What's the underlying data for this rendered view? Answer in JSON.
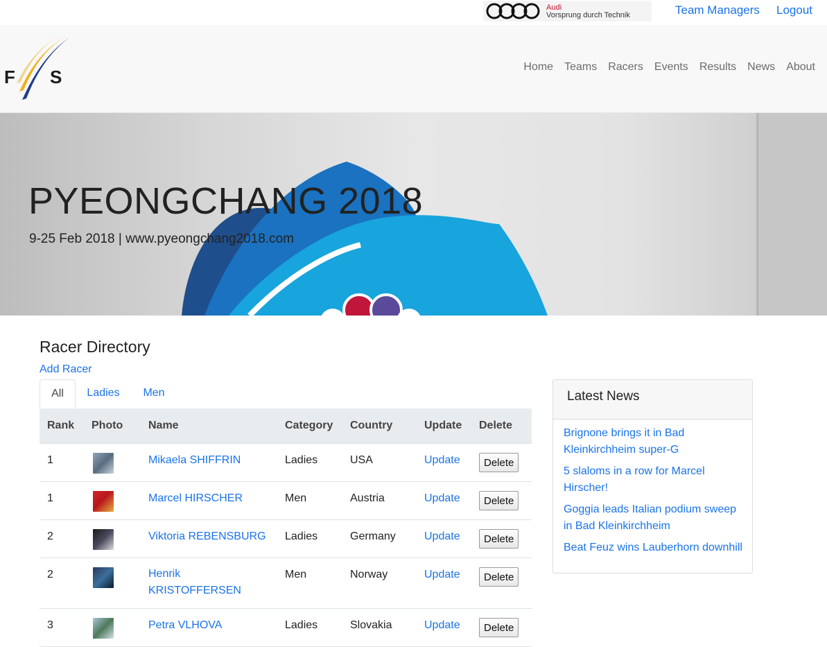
{
  "topbar": {
    "sponsor_brand": "Audi",
    "sponsor_tagline": "Vorsprung durch Technik",
    "team_managers": "Team Managers",
    "logout": "Logout"
  },
  "nav": {
    "items": [
      "Home",
      "Teams",
      "Racers",
      "Events",
      "Results",
      "News",
      "About"
    ]
  },
  "hero": {
    "title": "PYEONGCHANG 2018",
    "subtitle": "9-25 Feb 2018 | www.pyeongchang2018.com"
  },
  "directory": {
    "title": "Racer Directory",
    "add_racer": "Add Racer",
    "tabs": [
      "All",
      "Ladies",
      "Men"
    ],
    "active_tab": "All",
    "columns": [
      "Rank",
      "Photo",
      "Name",
      "Category",
      "Country",
      "Update",
      "Delete"
    ],
    "rows": [
      {
        "rank": "1",
        "name": "Mikaela SHIFFRIN",
        "category": "Ladies",
        "country": "USA",
        "update": "Update",
        "delete": "Delete"
      },
      {
        "rank": "1",
        "name": "Marcel HIRSCHER",
        "category": "Men",
        "country": "Austria",
        "update": "Update",
        "delete": "Delete"
      },
      {
        "rank": "2",
        "name": "Viktoria REBENSBURG",
        "category": "Ladies",
        "country": "Germany",
        "update": "Update",
        "delete": "Delete"
      },
      {
        "rank": "2",
        "name": "Henrik KRISTOFFERSEN",
        "category": "Men",
        "country": "Norway",
        "update": "Update",
        "delete": "Delete"
      },
      {
        "rank": "3",
        "name": "Petra VLHOVA",
        "category": "Ladies",
        "country": "Slovakia",
        "update": "Update",
        "delete": "Delete"
      }
    ]
  },
  "news": {
    "title": "Latest News",
    "items": [
      "Brignone brings it in Bad Kleinkirchheim super-G",
      "5 slaloms in a row for Marcel Hirscher!",
      "Goggia leads Italian podium sweep in Bad Kleinkirchheim",
      "Beat Feuz wins Lauberhorn downhill"
    ]
  },
  "colors": {
    "link": "#1a73e8",
    "nav_text": "#6b6b6b",
    "audi_red": "#c0142e"
  }
}
